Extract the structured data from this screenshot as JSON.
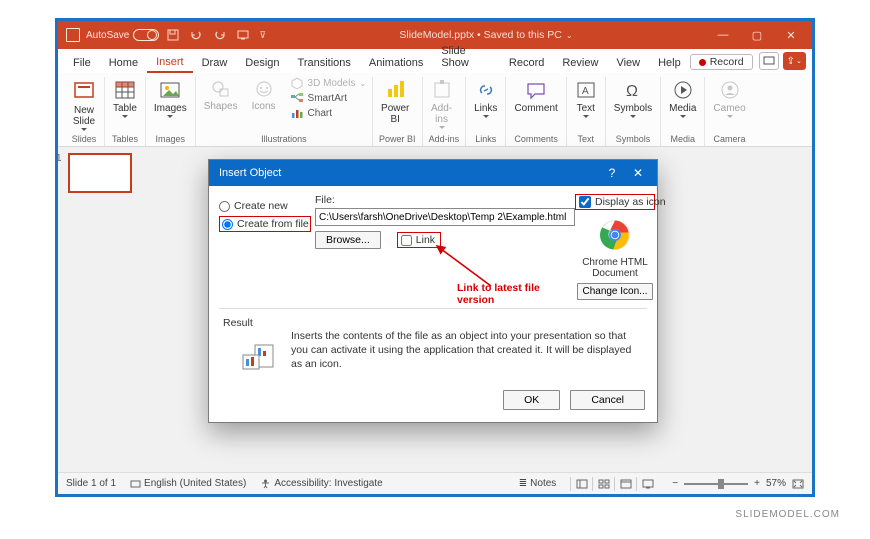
{
  "titlebar": {
    "autosave": "AutoSave",
    "document": "SlideModel.pptx • Saved to this PC"
  },
  "win": {
    "min": "—",
    "max": "▢",
    "close": "✕"
  },
  "tabs": [
    "File",
    "Home",
    "Insert",
    "Draw",
    "Design",
    "Transitions",
    "Animations",
    "Slide Show",
    "Record",
    "Review",
    "View",
    "Help"
  ],
  "record_btn": "Record",
  "ribbon": {
    "newslide": "New\nSlide",
    "table": "Table",
    "images": "Images",
    "shapes": "Shapes",
    "icons": "Icons",
    "models3d": "3D Models",
    "smartart": "SmartArt",
    "chart": "Chart",
    "powerbi": "Power\nBI",
    "addins": "Add-\nins",
    "links": "Links",
    "comment": "Comment",
    "text": "Text",
    "symbols": "Symbols",
    "media": "Media",
    "cameo": "Cameo",
    "g_slides": "Slides",
    "g_tables": "Tables",
    "g_images": "Images",
    "g_illus": "Illustrations",
    "g_pbi": "Power BI",
    "g_addins": "Add-ins",
    "g_links": "Links",
    "g_comm": "Comments",
    "g_text": "Text",
    "g_sym": "Symbols",
    "g_media": "Media",
    "g_cam": "Camera"
  },
  "thumb_num": "1",
  "dialog": {
    "title": "Insert Object",
    "create_new": "Create new",
    "create_from_file": "Create from file",
    "file_label": "File:",
    "file_path": "C:\\Users\\farsh\\OneDrive\\Desktop\\Temp 2\\Example.html",
    "browse": "Browse...",
    "link": "Link",
    "display_as_icon": "Display as icon",
    "icon_label": "Chrome HTML Document",
    "change_icon": "Change Icon...",
    "result": "Result",
    "result_text": "Inserts the contents of the file as an object into your presentation so that you can activate it using the application that created it. It will be displayed as an icon.",
    "ok": "OK",
    "cancel": "Cancel",
    "help": "?",
    "close": "✕"
  },
  "annotation": "Link to latest file version",
  "status": {
    "slide": "Slide 1 of 1",
    "lang": "English (United States)",
    "access": "Accessibility: Investigate",
    "notes": "Notes",
    "zoom": "57%"
  },
  "watermark": "SLIDEMODEL.COM"
}
